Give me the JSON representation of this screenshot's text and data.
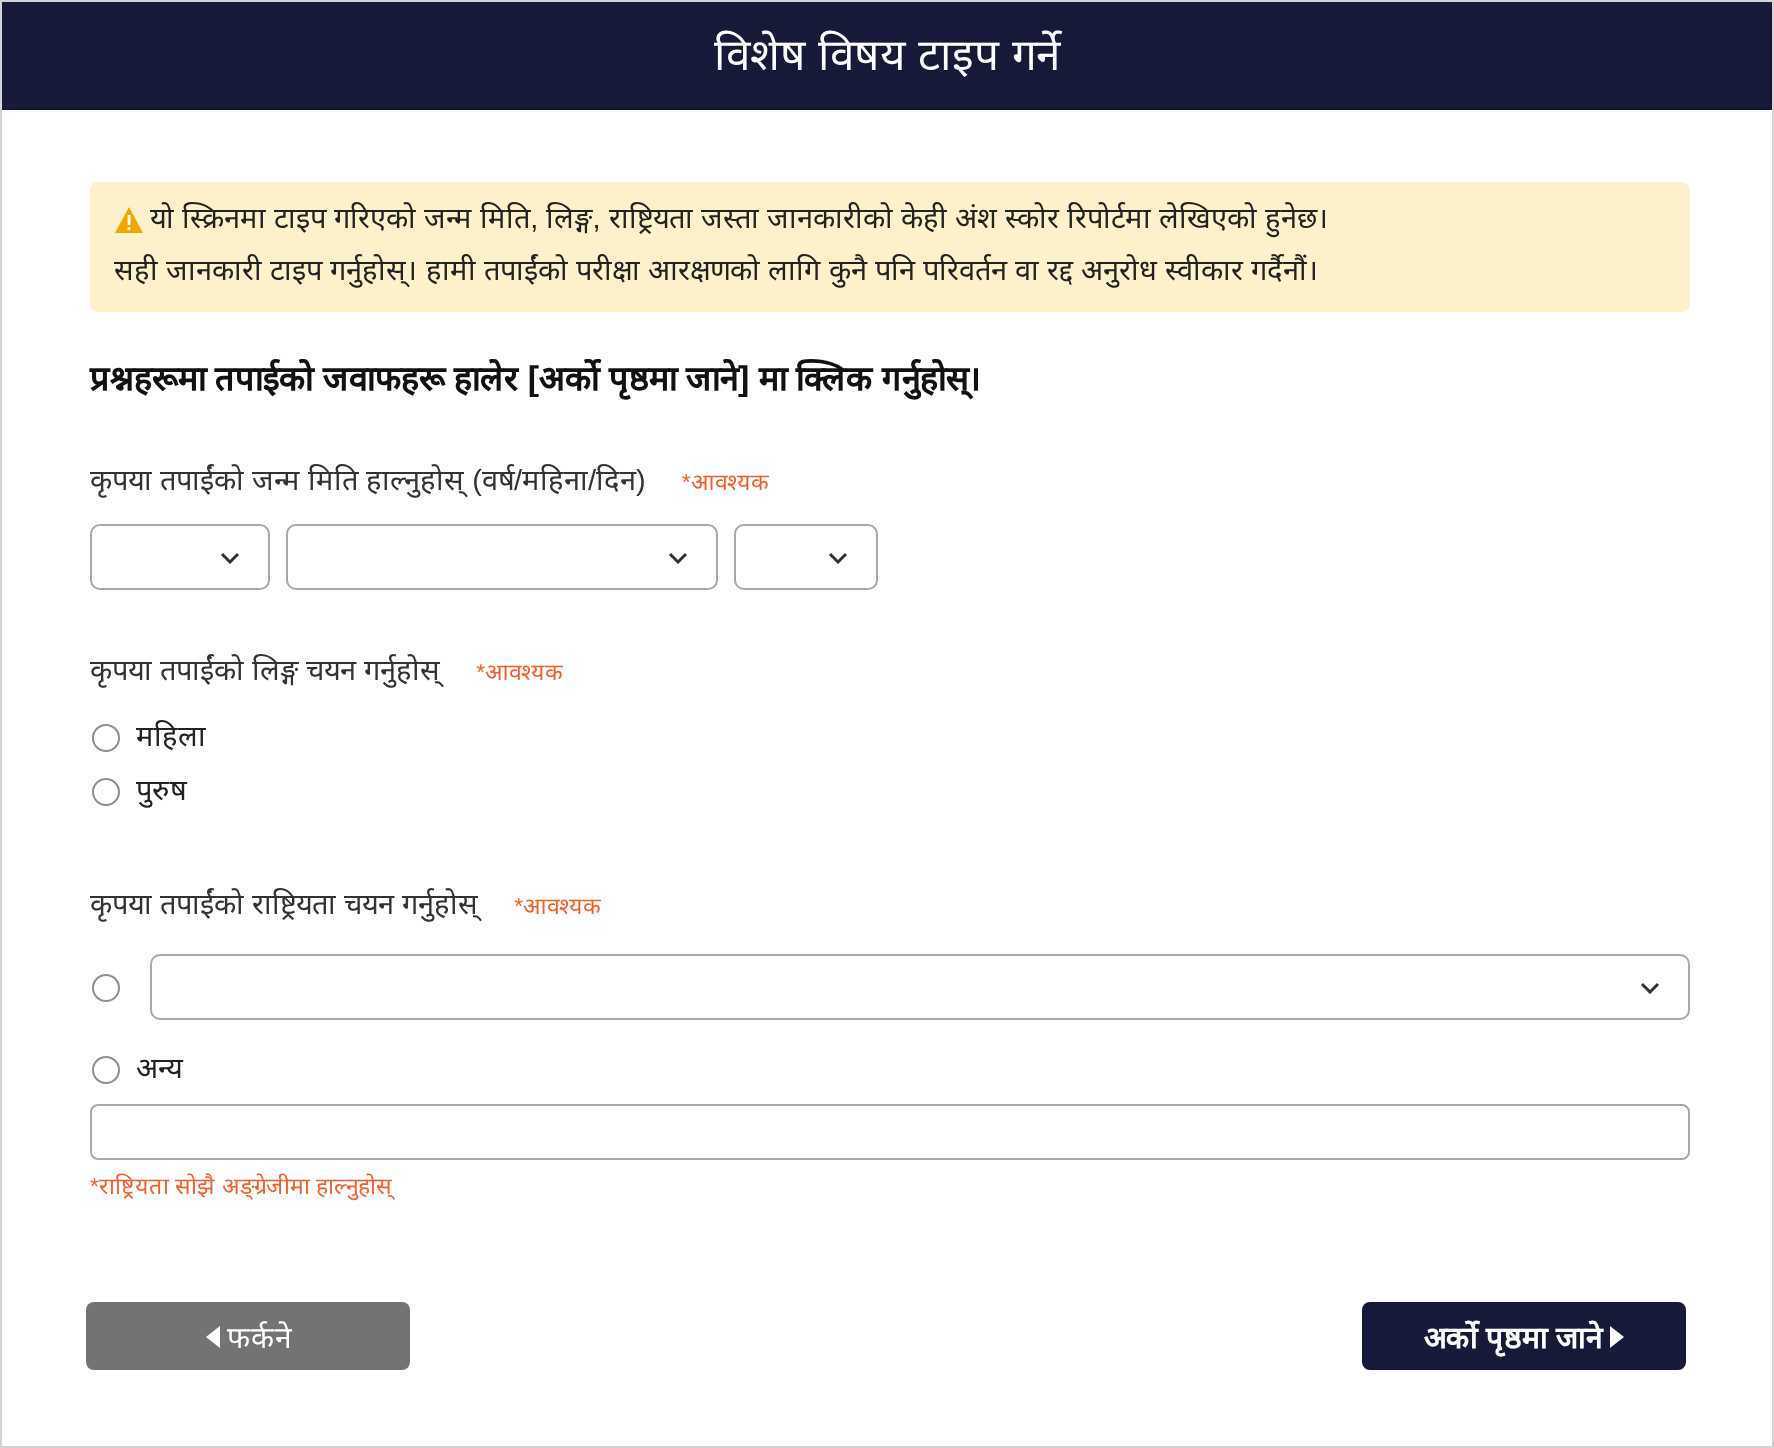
{
  "header": {
    "title": "विशेष विषय टाइप गर्ने"
  },
  "notice": {
    "lines": [
      "यो स्क्रिनमा टाइप गरिएको जन्म मिति, लिङ्ग, राष्ट्रियता जस्ता जानकारीको केही अंश स्कोर रिपोर्टमा लेखिएको हुनेछ।",
      "सही जानकारी टाइप गर्नुहोस्। हामी तपाईंको परीक्षा आरक्षणको लागि कुनै पनि परिवर्तन वा रद्द अनुरोध स्वीकार गर्दैनौं।"
    ]
  },
  "instruction": "प्रश्नहरूमा तपाईको जवाफहरू हालेर [अर्को पृष्ठमा जाने] मा क्लिक गर्नुहोस्।",
  "birth_date": {
    "label": "कृपया तपाईंको जन्म मिति हाल्नुहोस् (वर्ष/महिना/दिन)",
    "required": "*आवश्यक",
    "selects": [
      {
        "kind": "year"
      },
      {
        "kind": "month"
      },
      {
        "kind": "day"
      }
    ]
  },
  "gender": {
    "label": "कृपया तपाईंको लिङ्ग चयन गर्नुहोस्",
    "required": "*आवश्यक",
    "options": [
      {
        "label": "महिला",
        "selected": false
      },
      {
        "label": "पुरुष",
        "selected": false
      }
    ]
  },
  "nationality": {
    "label": "कृपया तपाईंको राष्ट्रियता चयन गर्नुहोस्",
    "required": "*आवश्यक",
    "options": [
      {
        "kind": "dropdown",
        "selected": false
      },
      {
        "kind": "other",
        "label": "अन्य",
        "selected": false
      }
    ],
    "hint": "*राष्ट्रियता सोझै अङ्ग्रेजीमा हाल्नुहोस्"
  },
  "buttons": [
    {
      "kind": "back",
      "label": "फर्कने"
    },
    {
      "kind": "next",
      "label": "अर्को पृष्ठमा जाने"
    }
  ]
}
